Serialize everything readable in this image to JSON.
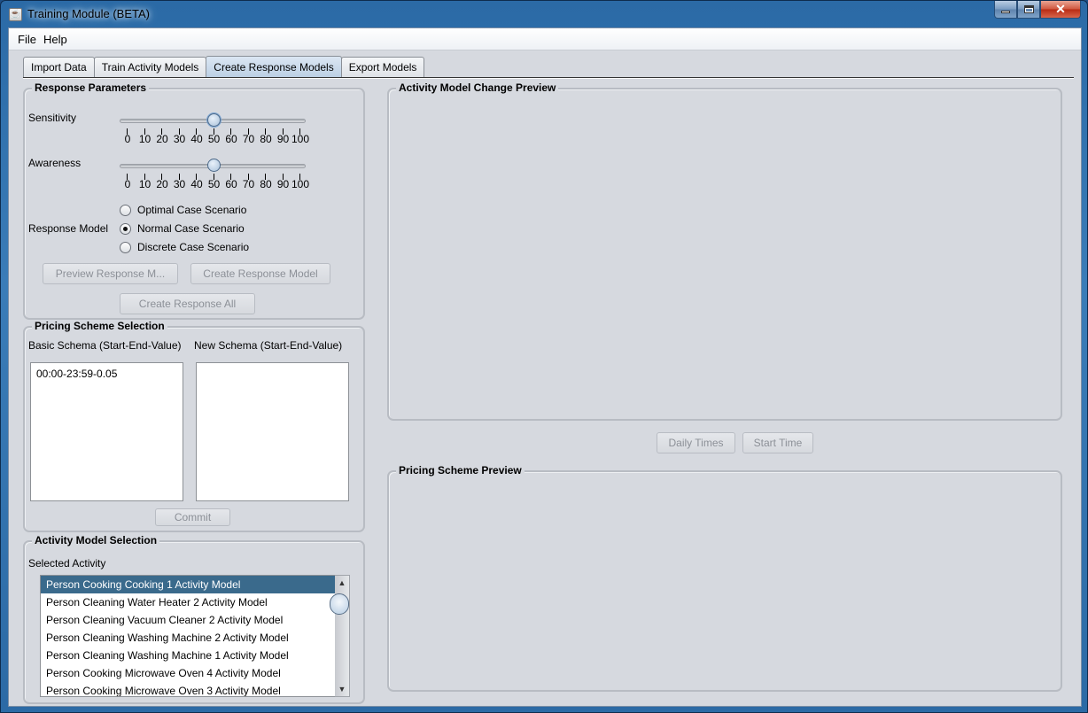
{
  "window": {
    "title": "Training Module (BETA)",
    "controls": {
      "minimize": "minimize",
      "maximize": "maximize",
      "close": "✕"
    }
  },
  "menu": [
    "File",
    "Help"
  ],
  "tabs": [
    {
      "label": "Import Data",
      "active": false
    },
    {
      "label": "Train Activity Models",
      "active": false
    },
    {
      "label": "Create Response Models",
      "active": true
    },
    {
      "label": "Export Models",
      "active": false
    }
  ],
  "response_parameters": {
    "title": "Response Parameters",
    "sensitivity": {
      "label": "Sensitivity",
      "value": 50,
      "min": 0,
      "max": 100
    },
    "awareness": {
      "label": "Awareness",
      "value": 50,
      "min": 0,
      "max": 100
    },
    "tick_labels": [
      "0",
      "10",
      "20",
      "30",
      "40",
      "50",
      "60",
      "70",
      "80",
      "90",
      "100"
    ],
    "response_model_label": "Response Model",
    "options": [
      {
        "label": "Optimal Case Scenario",
        "selected": false
      },
      {
        "label": "Normal Case Scenario",
        "selected": true
      },
      {
        "label": "Discrete Case Scenario",
        "selected": false
      }
    ],
    "buttons": {
      "preview": "Preview Response M...",
      "create": "Create Response Model",
      "create_all": "Create Response All"
    }
  },
  "pricing_scheme": {
    "title": "Pricing Scheme Selection",
    "basic_label": "Basic Schema (Start-End-Value)",
    "new_label": "New Schema (Start-End-Value)",
    "basic_entries": [
      "00:00-23:59-0.05"
    ],
    "new_entries": [],
    "commit": "Commit"
  },
  "activity_selection": {
    "title": "Activity Model Selection",
    "selected_label": "Selected Activity",
    "items": [
      "Person Cooking Cooking 1 Activity Model",
      "Person Cleaning Water Heater 2 Activity Model",
      "Person Cleaning Vacuum Cleaner 2 Activity Model",
      "Person Cleaning Washing Machine 2 Activity Model",
      "Person Cleaning Washing Machine 1 Activity Model",
      "Person Cooking Microwave Oven 4 Activity Model",
      "Person Cooking Microwave Oven 3 Activity Model"
    ],
    "selected_index": 0
  },
  "activity_preview": {
    "title": "Activity Model Change Preview"
  },
  "preview_buttons": {
    "daily_times": "Daily Times",
    "start_time": "Start Time"
  },
  "pricing_preview": {
    "title": "Pricing Scheme Preview"
  }
}
